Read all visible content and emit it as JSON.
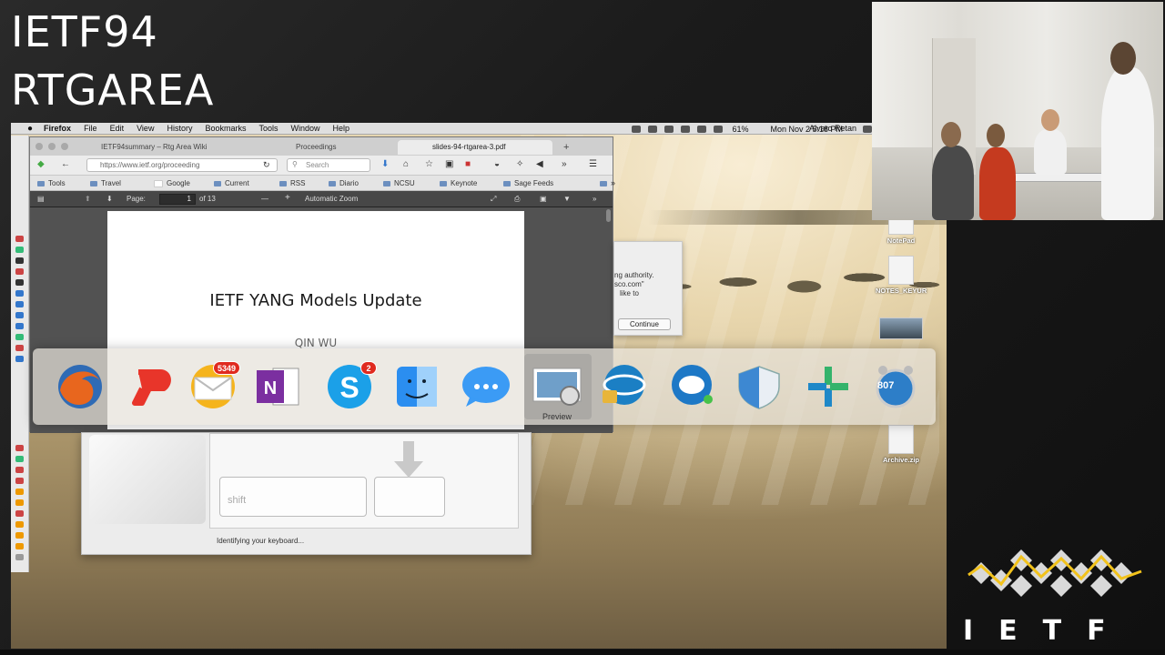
{
  "overlay": {
    "line1": "IETF94",
    "line2": "RTGAREA"
  },
  "menubar": {
    "apple": "",
    "items": [
      "Firefox",
      "File",
      "Edit",
      "View",
      "History",
      "Bookmarks",
      "Tools",
      "Window",
      "Help"
    ],
    "battery": "61%",
    "datetime": "Mon Nov 2  5:18 PM",
    "user": "Alvaro Retan"
  },
  "browser": {
    "tabs": [
      "IETF94summary – Rtg Area Wiki",
      "Proceedings",
      "slides-94-rtgarea-3.pdf"
    ],
    "new_tab": "+",
    "url": "https://www.ietf.org/proceeding",
    "search_placeholder": "Search",
    "bookmarks": [
      "Tools",
      "Travel",
      "Google",
      "Current",
      "RSS",
      "Diario",
      "NCSU",
      "Keynote",
      "Sage Feeds"
    ],
    "overflow": "»",
    "pdf": {
      "page_label": "Page:",
      "page_value": "1",
      "page_total": "of 13",
      "zoom": "Automatic Zoom",
      "minus": "—",
      "plus": "+"
    },
    "slide": {
      "title": "IETF YANG Models Update",
      "author": "QIN WU"
    }
  },
  "dialog": {
    "line1": "ng authority.",
    "line2": "sco.com\"",
    "line3": "like to",
    "button": "Continue"
  },
  "keyboard_assistant": {
    "shift": "shift",
    "status": "Identifying your keyboard..."
  },
  "dock": {
    "selected_label": "Preview",
    "apps": [
      {
        "name": "Firefox",
        "icon": "firefox-icon"
      },
      {
        "name": "Pocket",
        "icon": "pocket-icon"
      },
      {
        "name": "Mail",
        "icon": "mail-icon",
        "badge": "5349"
      },
      {
        "name": "OneNote",
        "icon": "onenote-icon"
      },
      {
        "name": "Skype",
        "icon": "skype-icon",
        "badge": "2"
      },
      {
        "name": "Finder",
        "icon": "finder-icon"
      },
      {
        "name": "Messages",
        "icon": "messages-icon"
      },
      {
        "name": "Preview",
        "icon": "preview-icon"
      },
      {
        "name": "AnyConnect",
        "icon": "anyconnect-icon"
      },
      {
        "name": "Jabber",
        "icon": "jabber-icon"
      },
      {
        "name": "Security",
        "icon": "shield-icon"
      },
      {
        "name": "Webex",
        "icon": "webex-icon"
      },
      {
        "name": "Alarm",
        "icon": "alarm-clock-icon",
        "badge": "807"
      }
    ]
  },
  "desktop_icons": [
    "NotePad",
    "NOTES_KEYUR",
    "",
    "Archive.zip"
  ],
  "ietf_logo": {
    "text": "IETF"
  },
  "colors": {
    "accent": "#f2c21b",
    "dock": "#e6e2da",
    "ietf_gray": "#d9d9d9"
  }
}
